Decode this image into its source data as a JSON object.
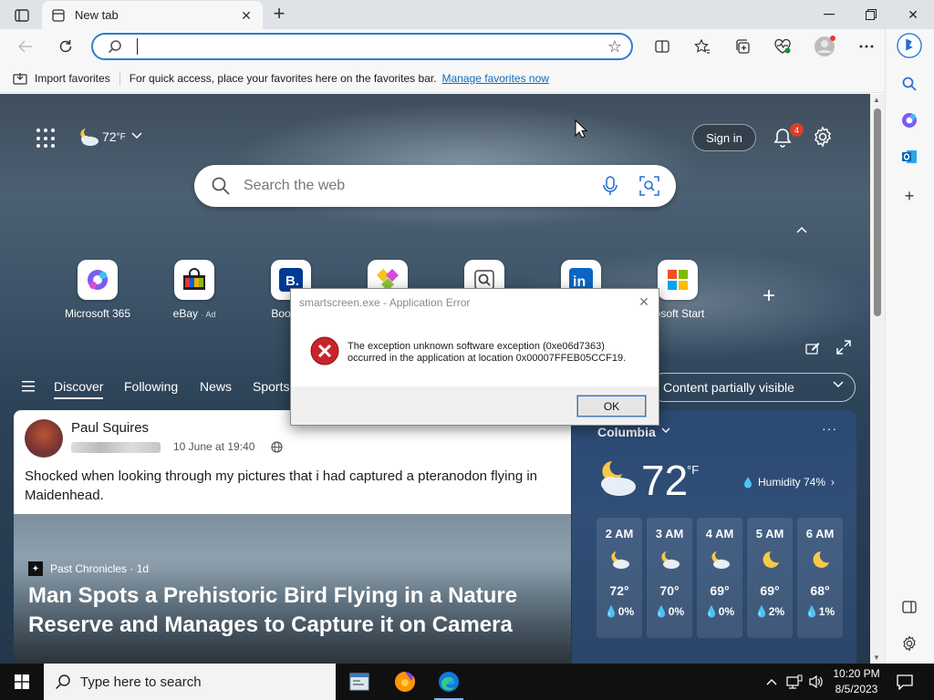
{
  "browser": {
    "tab_title": "New tab",
    "address_value": "",
    "favorites_bar": {
      "import_label": "Import favorites",
      "hint": "For quick access, place your favorites here on the favorites bar.",
      "manage_link": "Manage favorites now"
    }
  },
  "newtab": {
    "weather_mini_temp": "72",
    "weather_mini_unit": "°F",
    "signin_label": "Sign in",
    "notification_count": "4",
    "search_placeholder": "Search the web",
    "quick_links": [
      {
        "label": "Microsoft 365",
        "ad": ""
      },
      {
        "label": "eBay",
        "ad": "· Ad"
      },
      {
        "label": "Booking",
        "ad": ""
      },
      {
        "label": "",
        "ad": ""
      },
      {
        "label": "",
        "ad": ""
      },
      {
        "label": "",
        "ad": ""
      },
      {
        "label": "rosoft Start",
        "ad": ""
      }
    ],
    "feed_nav": [
      "Discover",
      "Following",
      "News",
      "Sports"
    ],
    "content_visibility": "Content partially visible"
  },
  "feed_card": {
    "author": "Paul Squires",
    "date": "10 June at 19:40",
    "post_text": "Shocked when looking through my pictures that i had captured a pteranodon flying in Maidenhead.",
    "source": "Past Chronicles · 1d",
    "headline": "Man Spots a Prehistoric Bird Flying in a Nature Reserve and Manages to Capture it on Camera"
  },
  "weather_card": {
    "location": "Columbia",
    "temp": "72",
    "unit": "°F",
    "humidity": "Humidity 74%",
    "hours": [
      {
        "time": "2 AM",
        "icon": "partly-cloudy-night-icon",
        "temp": "72°",
        "precip": "0%"
      },
      {
        "time": "3 AM",
        "icon": "partly-cloudy-night-icon",
        "temp": "70°",
        "precip": "0%"
      },
      {
        "time": "4 AM",
        "icon": "partly-cloudy-night-icon",
        "temp": "69°",
        "precip": "0%"
      },
      {
        "time": "5 AM",
        "icon": "moon-icon",
        "temp": "69°",
        "precip": "2%"
      },
      {
        "time": "6 AM",
        "icon": "moon-icon",
        "temp": "68°",
        "precip": "1%"
      }
    ]
  },
  "error_dialog": {
    "title": "smartscreen.exe - Application Error",
    "message_line1": "The exception unknown software exception (0xe06d7363)",
    "message_line2": "occurred in the application at location 0x00007FFEB05CCF19.",
    "ok_label": "OK"
  },
  "taskbar": {
    "search_placeholder": "Type here to search",
    "time": "10:20 PM",
    "date": "8/5/2023"
  },
  "colors": {
    "accent": "#2e7cd6",
    "badge": "#d93f2a",
    "error_red": "#c8242b"
  }
}
